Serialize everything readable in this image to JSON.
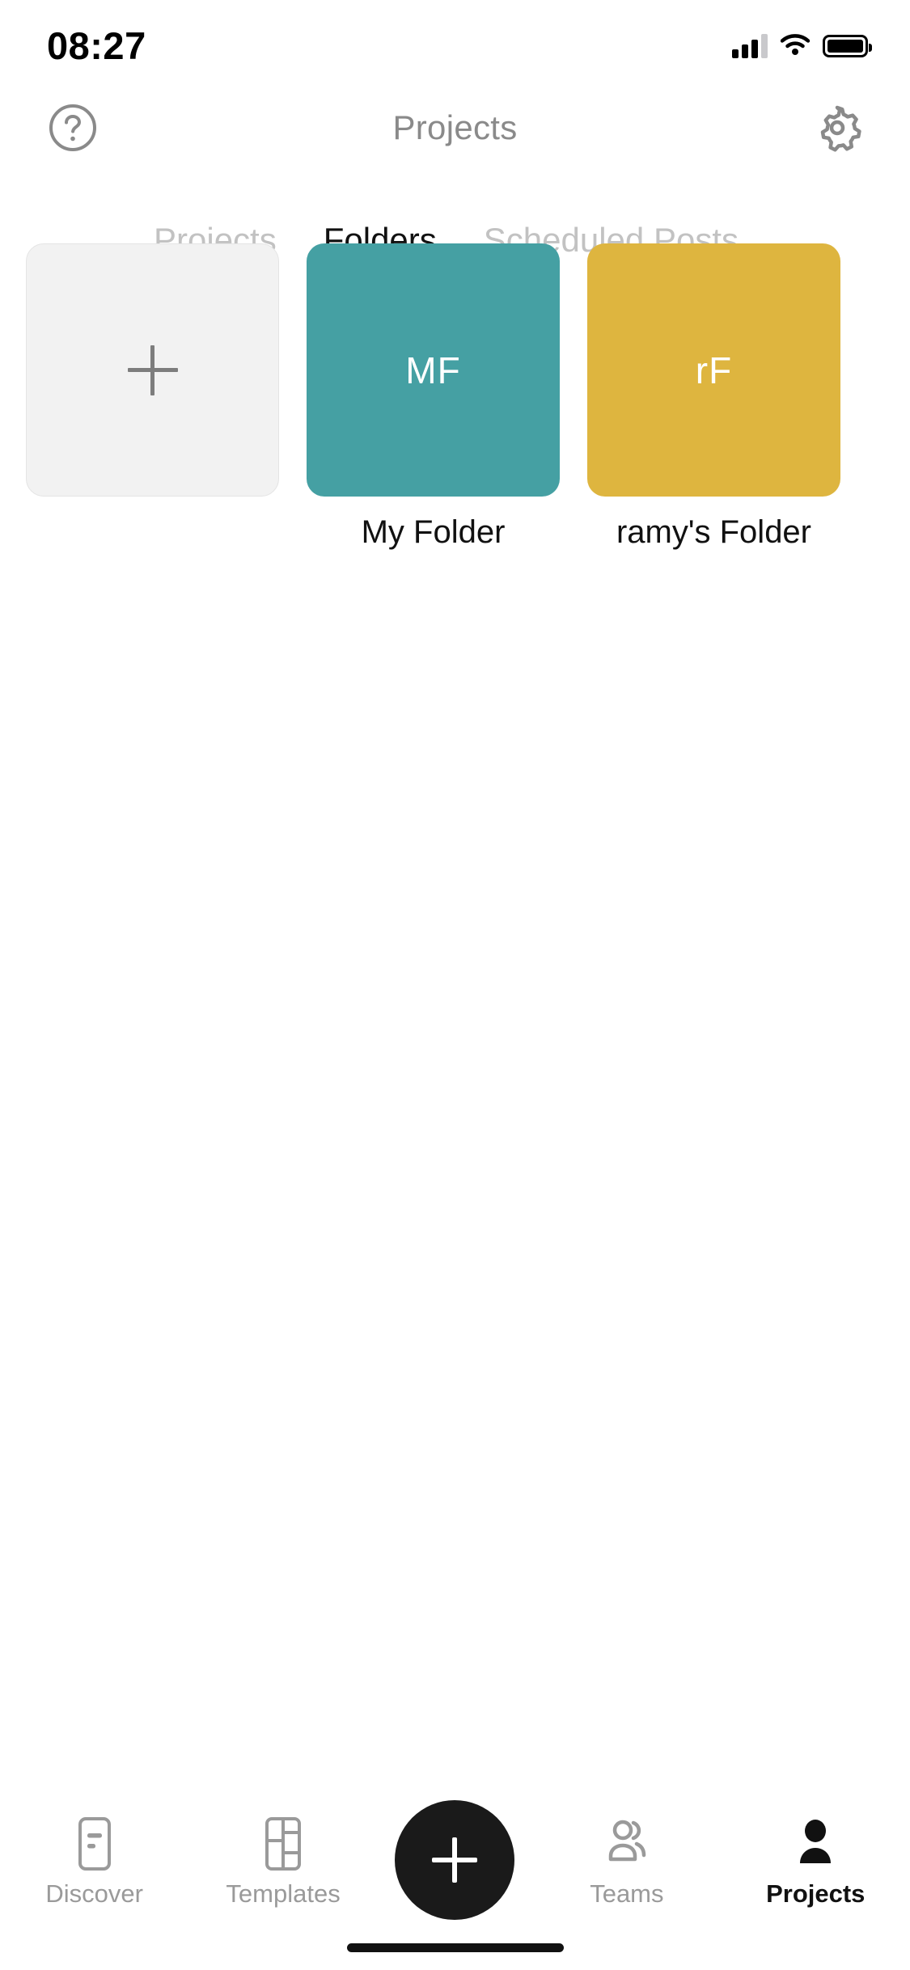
{
  "status_bar": {
    "time": "08:27",
    "icons": [
      "cellular-signal-icon",
      "wifi-icon",
      "battery-icon"
    ]
  },
  "header": {
    "title": "Projects",
    "left_icon": "help-circle-icon",
    "right_icon": "gear-icon"
  },
  "tabs": [
    {
      "label": "Projects",
      "active": false
    },
    {
      "label": "Folders",
      "active": true
    },
    {
      "label": "Scheduled Posts",
      "active": false
    }
  ],
  "folders": {
    "add_tile": {
      "label": "",
      "icon": "plus-icon",
      "background": "#f2f2f2"
    },
    "items": [
      {
        "initials": "MF",
        "label": "My Folder",
        "color": "#45a0a3"
      },
      {
        "initials": "rF",
        "label": "ramy's Folder",
        "color": "#deb53f"
      }
    ]
  },
  "bottom_nav": {
    "items": [
      {
        "label": "Discover",
        "icon": "document-icon",
        "active": false
      },
      {
        "label": "Templates",
        "icon": "grid-layout-icon",
        "active": false
      },
      {
        "label": "Teams",
        "icon": "people-icon",
        "active": false
      },
      {
        "label": "Projects",
        "icon": "person-icon",
        "active": true
      }
    ],
    "fab": {
      "icon": "plus-icon",
      "color": "#1a1a1a"
    }
  },
  "colors": {
    "accent_teal": "#45a0a3",
    "accent_yellow": "#deb53f",
    "active_text": "#111111",
    "inactive_text": "#c2c2c2",
    "nav_inactive": "#9a9a9a",
    "tile_placeholder": "#f2f2f2"
  }
}
